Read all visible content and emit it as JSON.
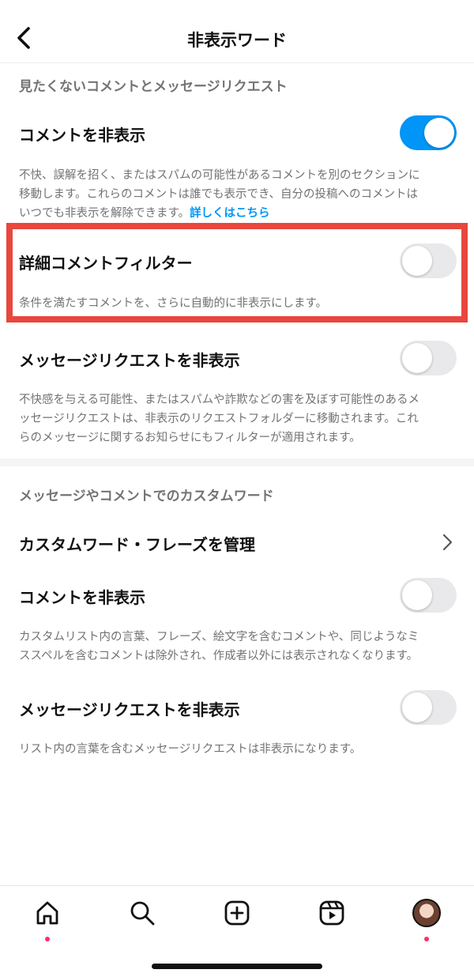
{
  "header": {
    "title": "非表示ワード"
  },
  "section1": {
    "heading": "見たくないコメントとメッセージリクエスト",
    "hide_comments": {
      "label": "コメントを非表示",
      "enabled": true,
      "desc_line1": "不快、誤解を招く、またはスパムの可能性があるコメントを別のセクションに",
      "desc_line2": "移動します。これらのコメントは誰でも表示でき、自分の投稿へのコメントは",
      "desc_line3": "いつでも非表示を解除できます。",
      "desc_link": "詳しくはこちら"
    },
    "advanced_filter": {
      "label": "詳細コメントフィルター",
      "enabled": false,
      "desc": "条件を満たすコメントを、さらに自動的に非表示にします。"
    },
    "hide_message_requests": {
      "label": "メッセージリクエストを非表示",
      "enabled": false,
      "desc_line1": "不快感を与える可能性、またはスパムや詐欺などの害を及ぼす可能性のあるメ",
      "desc_line2": "ッセージリクエストは、非表示のリクエストフォルダーに移動されます。これ",
      "desc_line3": "らのメッセージに関するお知らせにもフィルターが適用されます。"
    }
  },
  "section2": {
    "heading": "メッセージやコメントでのカスタムワード",
    "manage": {
      "label": "カスタムワード・フレーズを管理"
    },
    "hide_comments": {
      "label": "コメントを非表示",
      "enabled": false,
      "desc_line1": "カスタムリスト内の言葉、フレーズ、絵文字を含むコメントや、同じようなミ",
      "desc_line2": "ススペルを含むコメントは除外され、作成者以外には表示されなくなります。"
    },
    "hide_message_requests": {
      "label": "メッセージリクエストを非表示",
      "enabled": false,
      "desc": "リスト内の言葉を含むメッセージリクエストは非表示になります。"
    }
  },
  "tabbar": {
    "items": [
      "home-icon",
      "search-icon",
      "create-icon",
      "reels-icon",
      "profile-avatar"
    ],
    "notification_dot_color": "#ff2e63"
  },
  "colors": {
    "accent": "#0095f6",
    "highlight_border": "#e8473e",
    "secondary_text": "#737373"
  }
}
